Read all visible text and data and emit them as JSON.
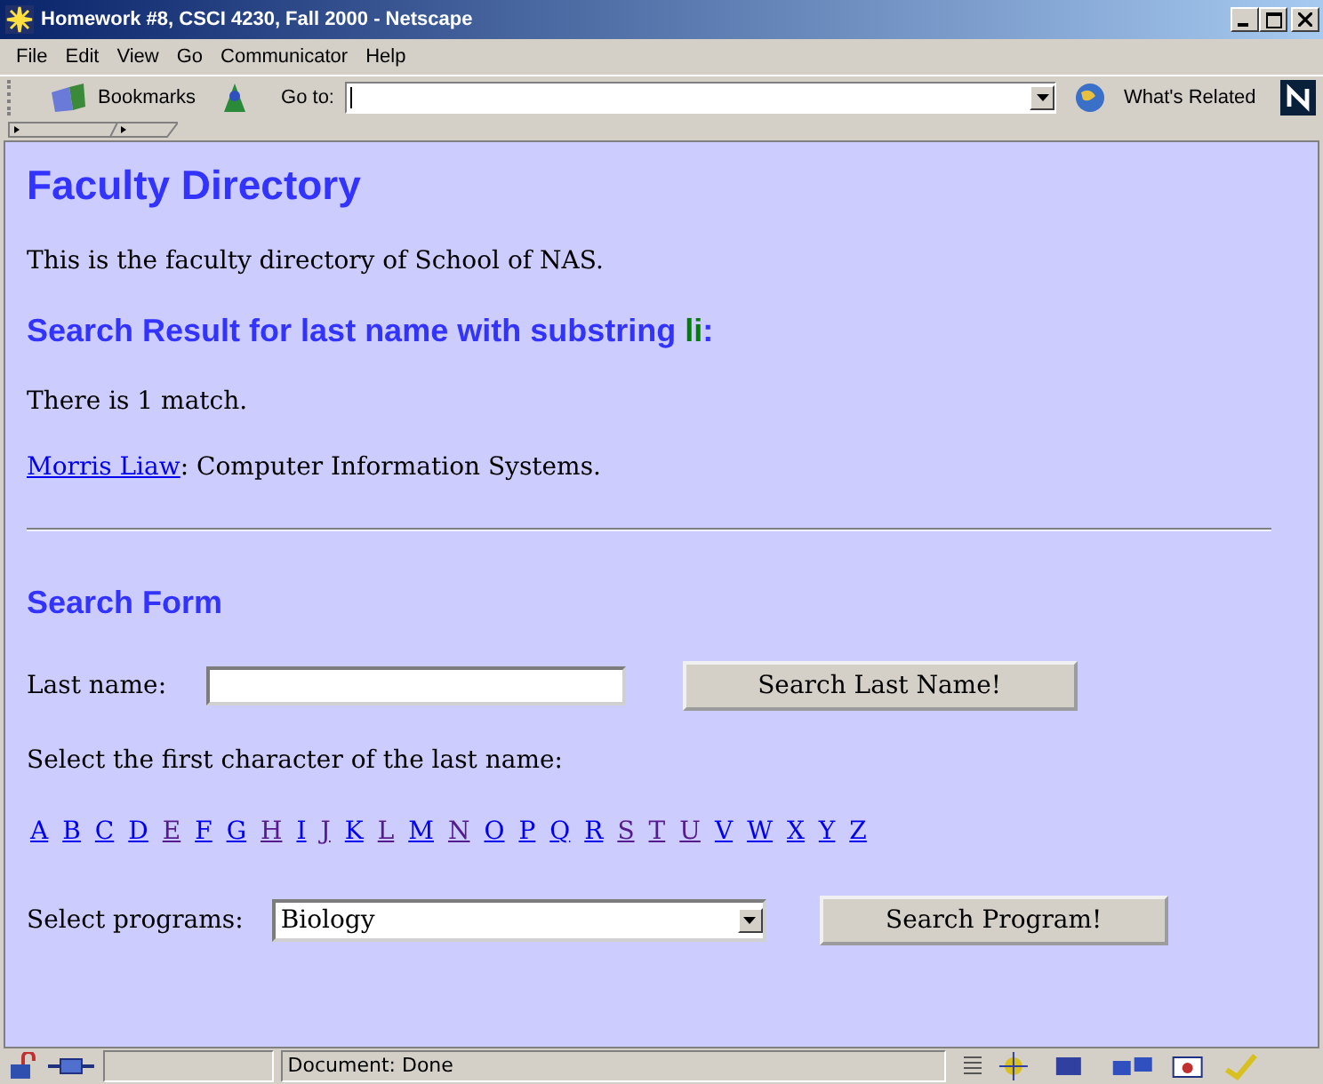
{
  "window": {
    "title": "Homework #8, CSCI 4230, Fall 2000 - Netscape"
  },
  "menu": [
    "File",
    "Edit",
    "View",
    "Go",
    "Communicator",
    "Help"
  ],
  "toolbar": {
    "bookmarks": "Bookmarks",
    "goto_label": "Go to:",
    "related": "What's Related"
  },
  "page": {
    "heading": "Faculty Directory",
    "intro": "This is the faculty directory of School of NAS.",
    "result_heading": "Search Result for last name with substring ",
    "result_term": "li",
    "result_colon": ":",
    "match_text": "There is 1 match.",
    "result_link": "Morris Liaw",
    "result_rest": ": Computer Information Systems.",
    "form_heading": "Search Form",
    "last_name_label": "Last name:",
    "search_name_button": "Search Last Name!",
    "letters_label": "Select the first character of the last name:",
    "letters": [
      {
        "label": "A",
        "visited": false
      },
      {
        "label": "B",
        "visited": false
      },
      {
        "label": "C",
        "visited": false
      },
      {
        "label": "D",
        "visited": false
      },
      {
        "label": "E",
        "visited": true
      },
      {
        "label": "F",
        "visited": false
      },
      {
        "label": "G",
        "visited": false
      },
      {
        "label": "H",
        "visited": true
      },
      {
        "label": "I",
        "visited": false
      },
      {
        "label": "J",
        "visited": true
      },
      {
        "label": "K",
        "visited": false
      },
      {
        "label": "L",
        "visited": true
      },
      {
        "label": "M",
        "visited": false
      },
      {
        "label": "N",
        "visited": true
      },
      {
        "label": "O",
        "visited": false
      },
      {
        "label": "P",
        "visited": false
      },
      {
        "label": "Q",
        "visited": false
      },
      {
        "label": "R",
        "visited": false
      },
      {
        "label": "S",
        "visited": true
      },
      {
        "label": "T",
        "visited": true
      },
      {
        "label": "U",
        "visited": true
      },
      {
        "label": "V",
        "visited": false
      },
      {
        "label": "W",
        "visited": false
      },
      {
        "label": "X",
        "visited": false
      },
      {
        "label": "Y",
        "visited": false
      },
      {
        "label": "Z",
        "visited": false
      }
    ],
    "programs_label": "Select programs:",
    "program_value": "Biology",
    "search_program_button": "Search Program!"
  },
  "status_bar": {
    "text": "Document: Done"
  }
}
